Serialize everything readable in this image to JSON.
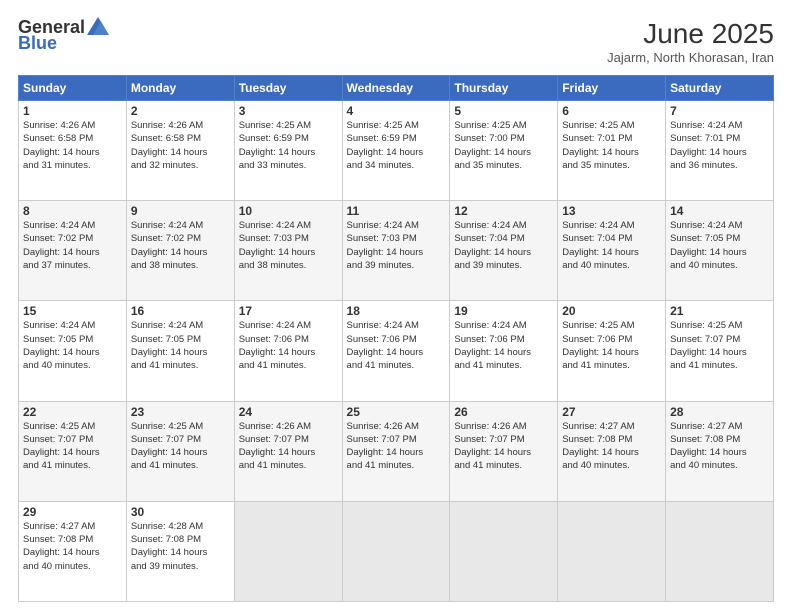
{
  "logo": {
    "general": "General",
    "blue": "Blue",
    "tagline": ""
  },
  "header": {
    "month_year": "June 2025",
    "location": "Jajarm, North Khorasan, Iran"
  },
  "weekdays": [
    "Sunday",
    "Monday",
    "Tuesday",
    "Wednesday",
    "Thursday",
    "Friday",
    "Saturday"
  ],
  "weeks": [
    [
      {
        "day": "1",
        "info": "Sunrise: 4:26 AM\nSunset: 6:58 PM\nDaylight: 14 hours\nand 31 minutes."
      },
      {
        "day": "2",
        "info": "Sunrise: 4:26 AM\nSunset: 6:58 PM\nDaylight: 14 hours\nand 32 minutes."
      },
      {
        "day": "3",
        "info": "Sunrise: 4:25 AM\nSunset: 6:59 PM\nDaylight: 14 hours\nand 33 minutes."
      },
      {
        "day": "4",
        "info": "Sunrise: 4:25 AM\nSunset: 6:59 PM\nDaylight: 14 hours\nand 34 minutes."
      },
      {
        "day": "5",
        "info": "Sunrise: 4:25 AM\nSunset: 7:00 PM\nDaylight: 14 hours\nand 35 minutes."
      },
      {
        "day": "6",
        "info": "Sunrise: 4:25 AM\nSunset: 7:01 PM\nDaylight: 14 hours\nand 35 minutes."
      },
      {
        "day": "7",
        "info": "Sunrise: 4:24 AM\nSunset: 7:01 PM\nDaylight: 14 hours\nand 36 minutes."
      }
    ],
    [
      {
        "day": "8",
        "info": "Sunrise: 4:24 AM\nSunset: 7:02 PM\nDaylight: 14 hours\nand 37 minutes."
      },
      {
        "day": "9",
        "info": "Sunrise: 4:24 AM\nSunset: 7:02 PM\nDaylight: 14 hours\nand 38 minutes."
      },
      {
        "day": "10",
        "info": "Sunrise: 4:24 AM\nSunset: 7:03 PM\nDaylight: 14 hours\nand 38 minutes."
      },
      {
        "day": "11",
        "info": "Sunrise: 4:24 AM\nSunset: 7:03 PM\nDaylight: 14 hours\nand 39 minutes."
      },
      {
        "day": "12",
        "info": "Sunrise: 4:24 AM\nSunset: 7:04 PM\nDaylight: 14 hours\nand 39 minutes."
      },
      {
        "day": "13",
        "info": "Sunrise: 4:24 AM\nSunset: 7:04 PM\nDaylight: 14 hours\nand 40 minutes."
      },
      {
        "day": "14",
        "info": "Sunrise: 4:24 AM\nSunset: 7:05 PM\nDaylight: 14 hours\nand 40 minutes."
      }
    ],
    [
      {
        "day": "15",
        "info": "Sunrise: 4:24 AM\nSunset: 7:05 PM\nDaylight: 14 hours\nand 40 minutes."
      },
      {
        "day": "16",
        "info": "Sunrise: 4:24 AM\nSunset: 7:05 PM\nDaylight: 14 hours\nand 41 minutes."
      },
      {
        "day": "17",
        "info": "Sunrise: 4:24 AM\nSunset: 7:06 PM\nDaylight: 14 hours\nand 41 minutes."
      },
      {
        "day": "18",
        "info": "Sunrise: 4:24 AM\nSunset: 7:06 PM\nDaylight: 14 hours\nand 41 minutes."
      },
      {
        "day": "19",
        "info": "Sunrise: 4:24 AM\nSunset: 7:06 PM\nDaylight: 14 hours\nand 41 minutes."
      },
      {
        "day": "20",
        "info": "Sunrise: 4:25 AM\nSunset: 7:06 PM\nDaylight: 14 hours\nand 41 minutes."
      },
      {
        "day": "21",
        "info": "Sunrise: 4:25 AM\nSunset: 7:07 PM\nDaylight: 14 hours\nand 41 minutes."
      }
    ],
    [
      {
        "day": "22",
        "info": "Sunrise: 4:25 AM\nSunset: 7:07 PM\nDaylight: 14 hours\nand 41 minutes."
      },
      {
        "day": "23",
        "info": "Sunrise: 4:25 AM\nSunset: 7:07 PM\nDaylight: 14 hours\nand 41 minutes."
      },
      {
        "day": "24",
        "info": "Sunrise: 4:26 AM\nSunset: 7:07 PM\nDaylight: 14 hours\nand 41 minutes."
      },
      {
        "day": "25",
        "info": "Sunrise: 4:26 AM\nSunset: 7:07 PM\nDaylight: 14 hours\nand 41 minutes."
      },
      {
        "day": "26",
        "info": "Sunrise: 4:26 AM\nSunset: 7:07 PM\nDaylight: 14 hours\nand 41 minutes."
      },
      {
        "day": "27",
        "info": "Sunrise: 4:27 AM\nSunset: 7:08 PM\nDaylight: 14 hours\nand 40 minutes."
      },
      {
        "day": "28",
        "info": "Sunrise: 4:27 AM\nSunset: 7:08 PM\nDaylight: 14 hours\nand 40 minutes."
      }
    ],
    [
      {
        "day": "29",
        "info": "Sunrise: 4:27 AM\nSunset: 7:08 PM\nDaylight: 14 hours\nand 40 minutes."
      },
      {
        "day": "30",
        "info": "Sunrise: 4:28 AM\nSunset: 7:08 PM\nDaylight: 14 hours\nand 39 minutes."
      },
      {
        "day": "",
        "info": ""
      },
      {
        "day": "",
        "info": ""
      },
      {
        "day": "",
        "info": ""
      },
      {
        "day": "",
        "info": ""
      },
      {
        "day": "",
        "info": ""
      }
    ]
  ]
}
